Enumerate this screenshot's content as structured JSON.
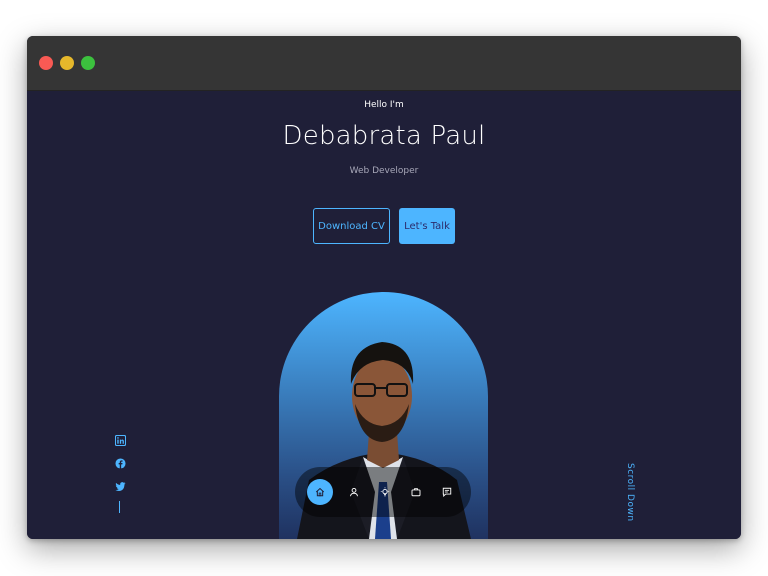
{
  "window": {
    "controls": [
      "close",
      "minimize",
      "zoom"
    ]
  },
  "hero": {
    "greeting": "Hello I'm",
    "name": "Debabrata Paul",
    "role": "Web Developer",
    "download_label": "Download CV",
    "talk_label": "Let's Talk"
  },
  "social": {
    "links": [
      "linkedin-icon",
      "facebook-icon",
      "twitter-icon"
    ]
  },
  "scroll_label": "Scroll Down",
  "nav": {
    "items": [
      "home-icon",
      "about-icon",
      "experience-icon",
      "portfolio-icon",
      "contact-icon"
    ],
    "active": "home-icon"
  },
  "colors": {
    "accent": "#4db5ff",
    "background": "#1f1f38",
    "button_text": "#2c2c6c"
  }
}
